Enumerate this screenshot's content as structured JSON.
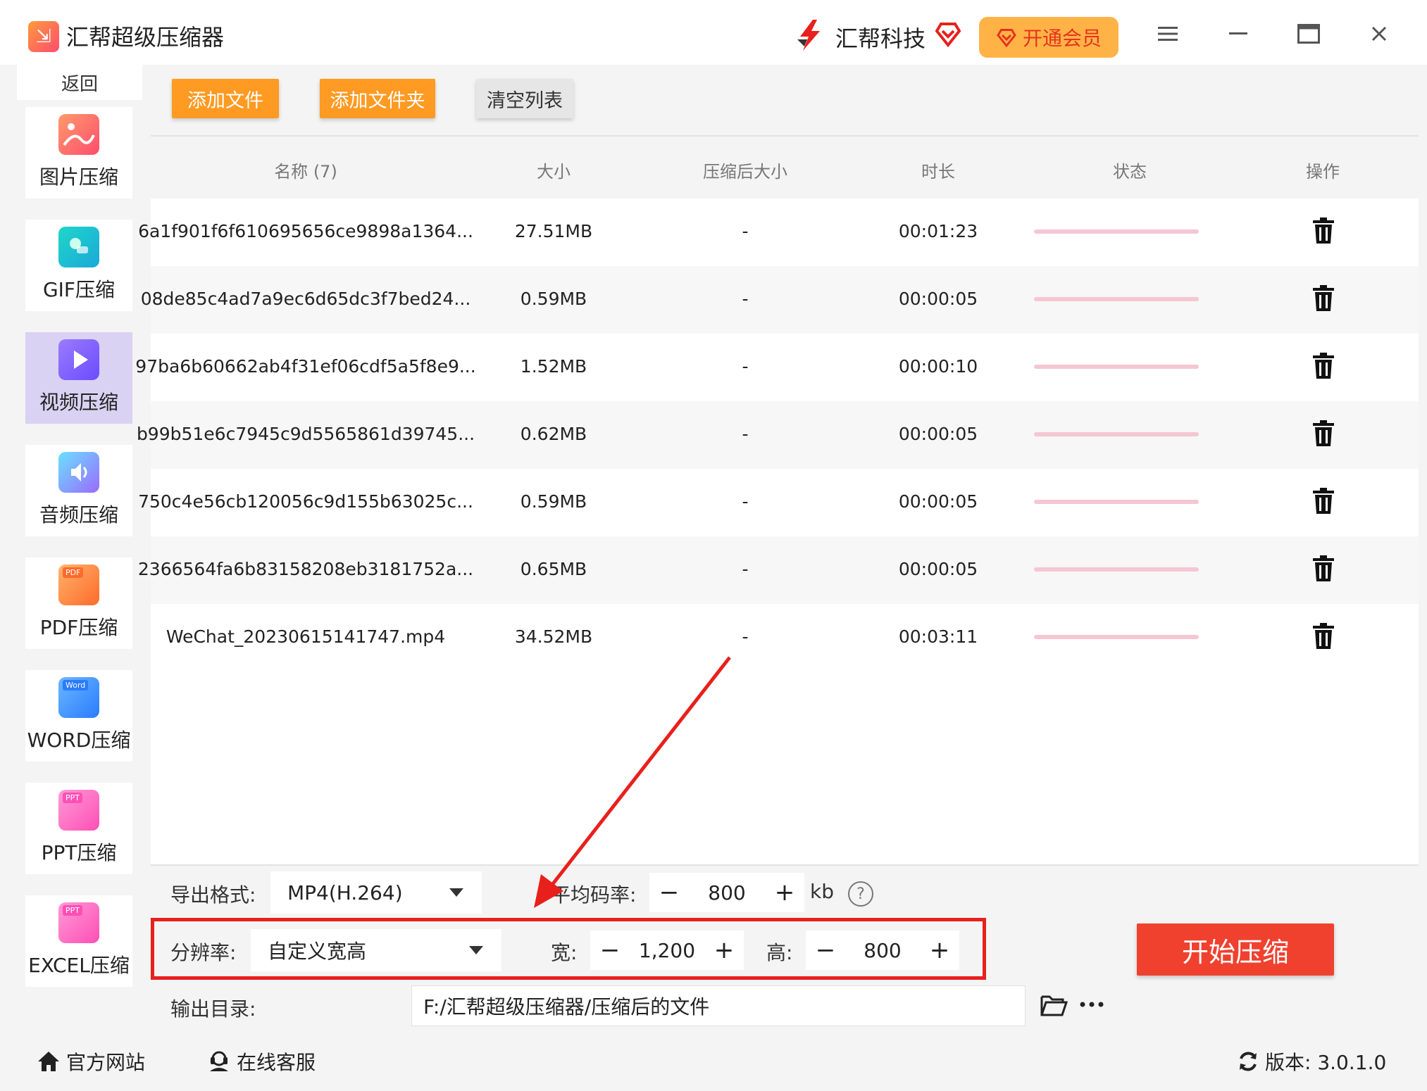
{
  "app": {
    "title": "汇帮超级压缩器",
    "brand": "汇帮科技",
    "vip_label": "开通会员"
  },
  "sidebar": {
    "back_label": "返回",
    "items": [
      {
        "label": "图片压缩",
        "icon": "image-icon"
      },
      {
        "label": "GIF压缩",
        "icon": "gif-icon"
      },
      {
        "label": "视频压缩",
        "icon": "video-icon",
        "active": true
      },
      {
        "label": "音频压缩",
        "icon": "audio-icon"
      },
      {
        "label": "PDF压缩",
        "icon": "pdf-icon",
        "badge": "PDF"
      },
      {
        "label": "WORD压缩",
        "icon": "word-icon",
        "badge": "Word"
      },
      {
        "label": "PPT压缩",
        "icon": "ppt-icon",
        "badge": "PPT"
      },
      {
        "label": "EXCEL压缩",
        "icon": "excel-icon",
        "badge": "PPT"
      }
    ]
  },
  "toolbar": {
    "add_file": "添加文件",
    "add_folder": "添加文件夹",
    "clear_list": "清空列表"
  },
  "table": {
    "headers": {
      "name": "名称 (7)",
      "size": "大小",
      "compressed": "压缩后大小",
      "duration": "时长",
      "status": "状态",
      "action": "操作"
    },
    "rows": [
      {
        "name": "6a1f901f6f610695656ce9898a1364...",
        "size": "27.51MB",
        "compressed": "-",
        "duration": "00:01:23"
      },
      {
        "name": "08de85c4ad7a9ec6d65dc3f7bed24...",
        "size": "0.59MB",
        "compressed": "-",
        "duration": "00:00:05"
      },
      {
        "name": "97ba6b60662ab4f31ef06cdf5a5f8e9...",
        "size": "1.52MB",
        "compressed": "-",
        "duration": "00:00:10"
      },
      {
        "name": "b99b51e6c7945c9d5565861d39745...",
        "size": "0.62MB",
        "compressed": "-",
        "duration": "00:00:05"
      },
      {
        "name": "750c4e56cb120056c9d155b63025c...",
        "size": "0.59MB",
        "compressed": "-",
        "duration": "00:00:05"
      },
      {
        "name": "2366564fa6b83158208eb3181752a...",
        "size": "0.65MB",
        "compressed": "-",
        "duration": "00:00:05"
      },
      {
        "name": "WeChat_20230615141747.mp4",
        "size": "34.52MB",
        "compressed": "-",
        "duration": "00:03:11"
      }
    ]
  },
  "settings": {
    "format_label": "导出格式:",
    "format_value": "MP4(H.264)",
    "bitrate_label": "平均码率:",
    "bitrate_value": "800",
    "bitrate_unit": "kb",
    "resolution_label": "分辨率:",
    "resolution_value": "自定义宽高",
    "width_label": "宽:",
    "width_value": "1,200",
    "height_label": "高:",
    "height_value": "800",
    "output_label": "输出目录:",
    "output_value": "F:/汇帮超级压缩器/压缩后的文件",
    "start_label": "开始压缩"
  },
  "footer": {
    "website": "官方网站",
    "support": "在线客服",
    "version": "版本: 3.0.1.0"
  },
  "colors": {
    "accent_orange": "#ff9a22",
    "start_red": "#f0412f",
    "highlight_red": "#e8201c",
    "vip_bg": "#ffb347",
    "active_side": "#d9d2f3"
  }
}
